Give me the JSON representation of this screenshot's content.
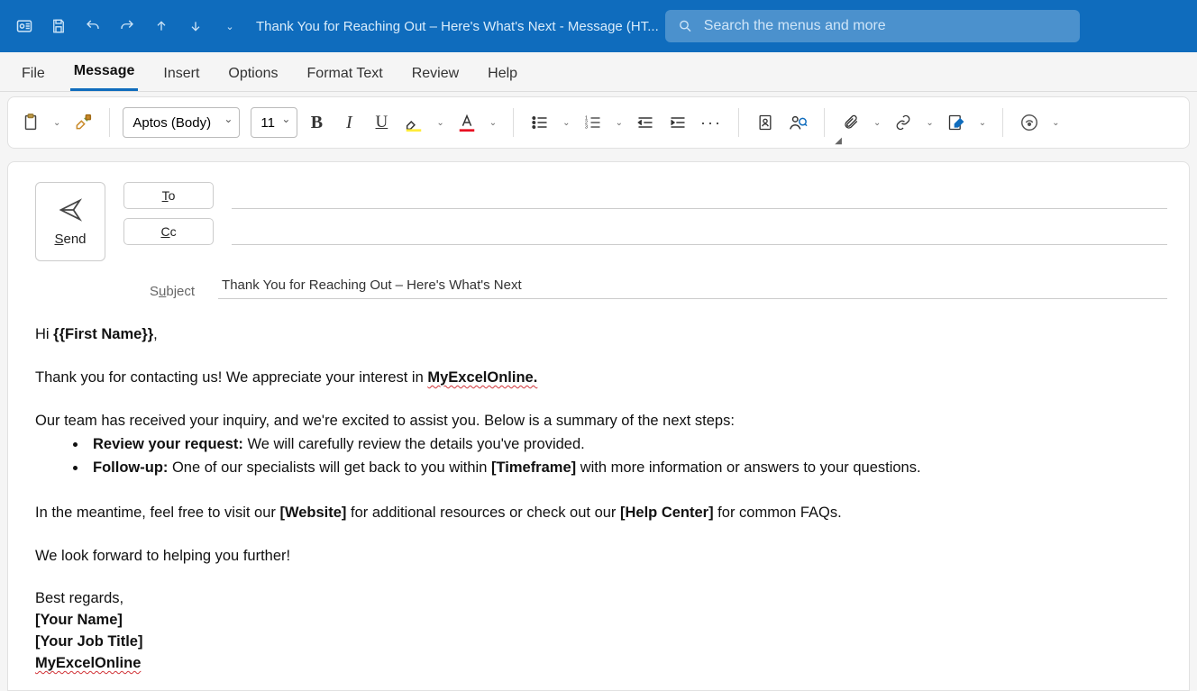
{
  "titlebar": {
    "title": "Thank You for Reaching Out – Here's What's Next  -  Message (HT...",
    "search_placeholder": "Search the menus and more"
  },
  "tabs": {
    "file": "File",
    "message": "Message",
    "insert": "Insert",
    "options": "Options",
    "format_text": "Format Text",
    "review": "Review",
    "help": "Help"
  },
  "ribbon": {
    "font_name": "Aptos (Body)",
    "font_size": "11"
  },
  "compose": {
    "send": "Send",
    "to": "To",
    "cc": "Cc",
    "subject_label": "Subject",
    "subject_value": "Thank You for Reaching Out – Here's What's Next"
  },
  "body": {
    "greeting_prefix": "Hi ",
    "greeting_name": "{{First Name}}",
    "greeting_suffix": ",",
    "p1a": "Thank you for contacting us! We appreciate your interest in ",
    "p1b": "MyExcelOnline.",
    "p2": "Our team has received your inquiry, and we're excited to assist you. Below is a summary of the next steps:",
    "li1_b": "Review your request:",
    "li1_t": " We will carefully review the details you've provided.",
    "li2_b": "Follow-up:",
    "li2_t1": " One of our specialists will get back to you within ",
    "li2_tf": "[Timeframe]",
    "li2_t2": " with more information or answers to your questions.",
    "p3a": "In the meantime, feel free to visit our ",
    "p3b": "[Website]",
    "p3c": " for additional resources or check out our ",
    "p3d": "[Help Center]",
    "p3e": " for common FAQs.",
    "p4": "We look forward to helping you further!",
    "sig1": "Best regards,",
    "sig2": "[Your Name]",
    "sig3": "[Your Job Title]",
    "sig4": "MyExcelOnline"
  }
}
